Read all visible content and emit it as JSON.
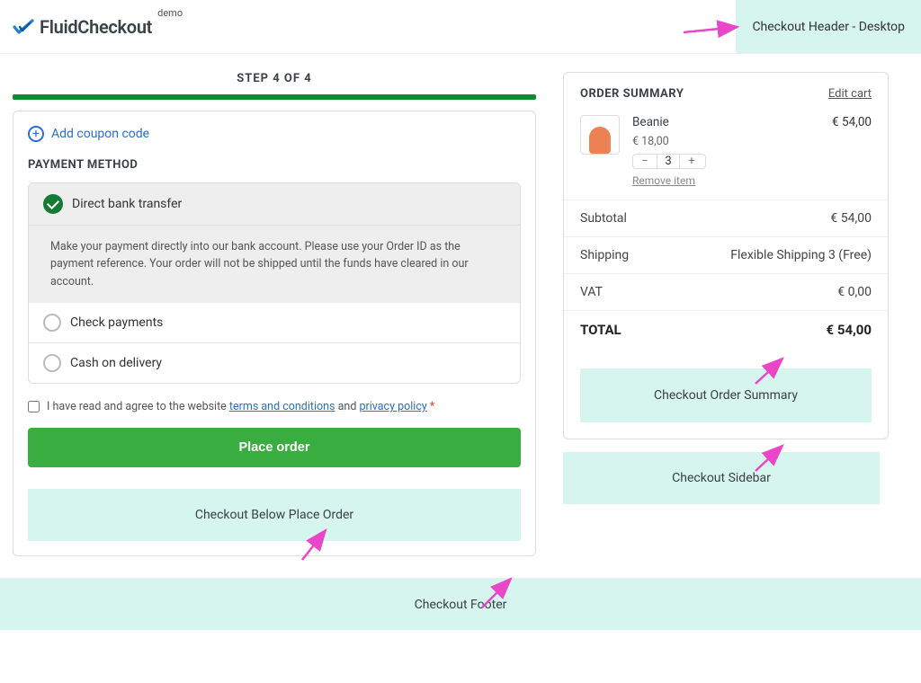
{
  "header": {
    "brand_main": "FluidCheckout",
    "brand_tag": "demo",
    "widget_label": "Checkout Header - Desktop"
  },
  "step": {
    "label": "STEP 4 OF 4"
  },
  "coupon": {
    "label": "Add coupon code"
  },
  "payment": {
    "heading": "PAYMENT METHOD",
    "methods": {
      "bank": {
        "label": "Direct bank transfer"
      },
      "check": {
        "label": "Check payments"
      },
      "cod": {
        "label": "Cash on delivery"
      }
    },
    "bank_description": "Make your payment directly into our bank account. Please use your Order ID as the payment reference. Your order will not be shipped until the funds have cleared in our account."
  },
  "terms": {
    "prefix": "I have read and agree to the website",
    "tc_label": "terms and conditions",
    "sep": "and",
    "pp_label": "privacy policy"
  },
  "place_order": "Place order",
  "below_place_widget": "Checkout Below Place Order",
  "summary": {
    "title": "ORDER SUMMARY",
    "edit": "Edit cart",
    "product": {
      "name": "Beanie",
      "unit_price": "€ 18,00",
      "qty": "3",
      "line_total": "€ 54,00",
      "remove": "Remove item"
    },
    "rows": {
      "subtotal_label": "Subtotal",
      "subtotal_value": "€ 54,00",
      "shipping_label": "Shipping",
      "shipping_value": "Flexible Shipping 3 (Free)",
      "vat_label": "VAT",
      "vat_value": "€ 0,00",
      "total_label": "TOTAL",
      "total_value": "€ 54,00"
    },
    "inner_widget": "Checkout Order Summary"
  },
  "sidebar_widget": "Checkout Sidebar",
  "footer_widget": "Checkout Footer"
}
